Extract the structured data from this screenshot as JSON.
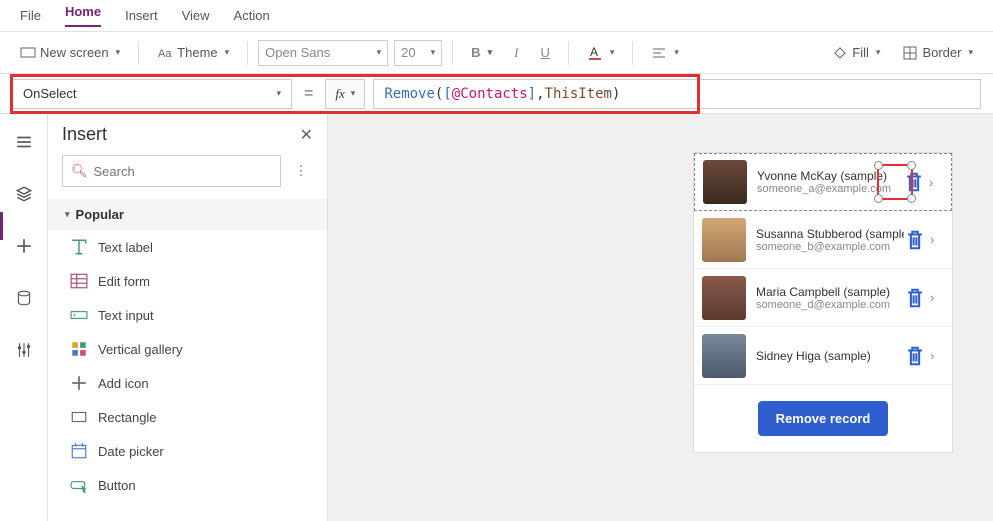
{
  "menu": {
    "file": "File",
    "home": "Home",
    "insert": "Insert",
    "view": "View",
    "action": "Action"
  },
  "ribbon": {
    "new_screen": "New screen",
    "theme": "Theme",
    "font_name": "Open Sans",
    "font_size": "20",
    "bold": "B",
    "italic": "I",
    "underline": "U",
    "fill": "Fill",
    "border": "Border"
  },
  "formula": {
    "property": "OnSelect",
    "fx_label": "fx",
    "tokens": {
      "func": "Remove",
      "open": "( ",
      "brkt_l": "[",
      "ident": "@Contacts",
      "brkt_r": "]",
      "comma": ", ",
      "this": "ThisItem",
      "close": " )"
    }
  },
  "insert_panel": {
    "title": "Insert",
    "search_placeholder": "Search",
    "category": "Popular",
    "items": [
      {
        "label": "Text label"
      },
      {
        "label": "Edit form"
      },
      {
        "label": "Text input"
      },
      {
        "label": "Vertical gallery"
      },
      {
        "label": "Add icon"
      },
      {
        "label": "Rectangle"
      },
      {
        "label": "Date picker"
      },
      {
        "label": "Button"
      }
    ]
  },
  "canvas": {
    "contacts": [
      {
        "name": "Yvonne McKay (sample)",
        "email": "someone_a@example.com"
      },
      {
        "name": "Susanna Stubberod (sample)",
        "email": "someone_b@example.com"
      },
      {
        "name": "Maria Campbell (sample)",
        "email": "someone_d@example.com"
      },
      {
        "name": "Sidney Higa (sample)",
        "email": ""
      }
    ],
    "remove_button": "Remove record"
  }
}
